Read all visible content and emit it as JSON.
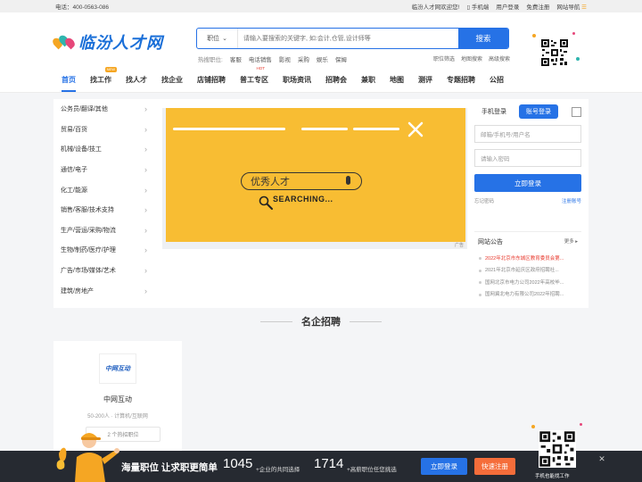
{
  "topbar": {
    "phone": "电话：400-0563-086",
    "welcome": "临汾人才网欢迎您!",
    "mobile": "手机端",
    "login": "用户登录",
    "register": "免费注册",
    "sitenav": "网站导航"
  },
  "header": {
    "logo_text": "临汾人才网",
    "search_category": "职位",
    "search_placeholder": "请输入要搜索的关键字, 如:会计,仓管,设计师等",
    "search_button": "搜索",
    "hot_label": "热搜职位:",
    "hot_words": [
      "客服",
      "电话销售",
      "影视",
      "采购",
      "娱乐",
      "保姆"
    ],
    "links": [
      "职位筛选",
      "地图搜索",
      "高级搜索"
    ]
  },
  "nav": {
    "items": [
      {
        "label": "首页",
        "badge": ""
      },
      {
        "label": "找工作",
        "badge": "NEW"
      },
      {
        "label": "找人才",
        "badge": ""
      },
      {
        "label": "找企业",
        "badge": ""
      },
      {
        "label": "店铺招聘",
        "badge": ""
      },
      {
        "label": "普工专区",
        "badge": "HOT"
      },
      {
        "label": "职场资讯",
        "badge": ""
      },
      {
        "label": "招聘会",
        "badge": ""
      },
      {
        "label": "兼职",
        "badge": ""
      },
      {
        "label": "地图",
        "badge": ""
      },
      {
        "label": "测评",
        "badge": ""
      },
      {
        "label": "专题招聘",
        "badge": ""
      },
      {
        "label": "公招",
        "badge": ""
      }
    ]
  },
  "categories": [
    "公务员/翻译/其他",
    "贸易/百货",
    "机械/设备/技工",
    "通信/电子",
    "化工/能源",
    "销售/客服/技术支持",
    "生产/营运/采购/物流",
    "生物/制药/医疗/护理",
    "广告/市场/媒体/艺术",
    "建筑/房地产"
  ],
  "banner": {
    "search_text": "优秀人才",
    "searching": "SEARCHING...",
    "ad_tag": "广告"
  },
  "login": {
    "tab_phone": "手机登录",
    "tab_account": "账号登录",
    "username_placeholder": "邮箱/手机号/用户名",
    "password_placeholder": "请输入密码",
    "submit": "立即登录",
    "forgot": "忘记密码",
    "register": "注册账号"
  },
  "notice": {
    "title": "网站公告",
    "more": "更多",
    "items": [
      "2022年北京市东城区教育委员会第...",
      "2021年北京市延庆区政府招聘社...",
      "国网北京市电力公司2022年高校毕...",
      "国网冀北电力有限公司2022年招聘..."
    ]
  },
  "section": {
    "title": "名企招聘"
  },
  "company": {
    "logo_text": "中网互动",
    "name": "中网互动",
    "info": "50-200人 · 计算机/互联网",
    "jobs": "2 个热招职位"
  },
  "bottombar": {
    "slogan": "海量职位 让求职更简单",
    "num1": "1045",
    "txt1": "+企业的共同选择",
    "num2": "1714",
    "txt2": "+高薪职位任您挑选",
    "login": "立即登录",
    "register": "快速注册",
    "qr_text": "手机也能找工作"
  },
  "colors": {
    "primary": "#2672e6",
    "banner": "#f8bd33",
    "register": "#f56d3a",
    "hot": "#e8382c"
  }
}
